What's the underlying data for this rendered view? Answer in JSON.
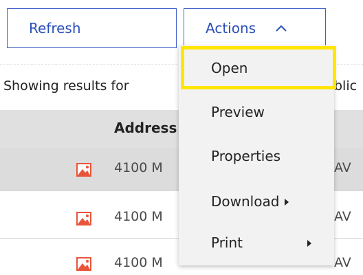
{
  "toolbar": {
    "refresh_label": "Refresh",
    "actions_label": "Actions"
  },
  "results": {
    "prefix": "Showing results for",
    "suffix": "blic"
  },
  "table": {
    "column_header": "Address",
    "rows": [
      {
        "visible_text": "4100 M",
        "tail": "AV"
      },
      {
        "visible_text": "4100 M",
        "tail": "AV"
      },
      {
        "visible_text": "4100 M",
        "tail": "AV"
      }
    ]
  },
  "actions_menu": {
    "items": [
      {
        "label": "Open",
        "highlighted": true
      },
      {
        "label": "Preview"
      },
      {
        "label": "Properties"
      },
      {
        "label": "Download",
        "has_submenu": true
      },
      {
        "label": "Print",
        "has_submenu": true
      }
    ]
  },
  "icons": {
    "row_icon": "image-file-icon",
    "actions_chevron": "chevron-up-icon",
    "submenu_arrow": "caret-right-icon"
  },
  "colors": {
    "accent": "#2a4fb8",
    "button_border": "#3d5fc8",
    "highlight": "#ffe600",
    "image_icon": "#e8553a",
    "header_bg": "#e0e0e0",
    "selected_row_bg": "#dcdcdc",
    "menu_bg": "#f2f2f2"
  }
}
